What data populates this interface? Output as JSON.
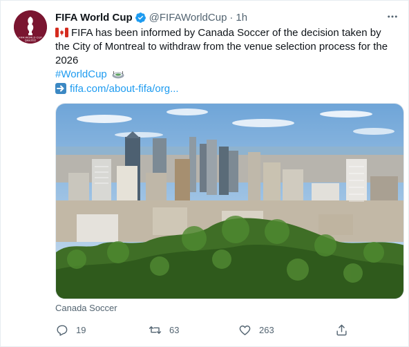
{
  "tweet": {
    "author": {
      "name": "FIFA World Cup",
      "handle": "@FIFAWorldCup",
      "time": "1h",
      "separator": "·",
      "avatar_text": "FIFA WORLD CUP Qatar2022"
    },
    "text": "FIFA has been informed by Canada Soccer of the decision taken by the City of Montreal to withdraw from the venue selection process for the 2026",
    "hashtag": "#WorldCup",
    "link": "fifa.com/about-fifa/org...",
    "media_caption": "Canada Soccer",
    "counts": {
      "replies": "19",
      "retweets": "63",
      "likes": "263"
    }
  },
  "icons": [
    "more-icon",
    "verified-icon",
    "canada-flag-icon",
    "stadium-icon",
    "arrow-right-icon",
    "reply-icon",
    "retweet-icon",
    "like-icon",
    "share-icon"
  ],
  "colors": {
    "link": "#1d9bf0",
    "secondary_text": "#536471",
    "avatar_bg": "#7a1530"
  }
}
